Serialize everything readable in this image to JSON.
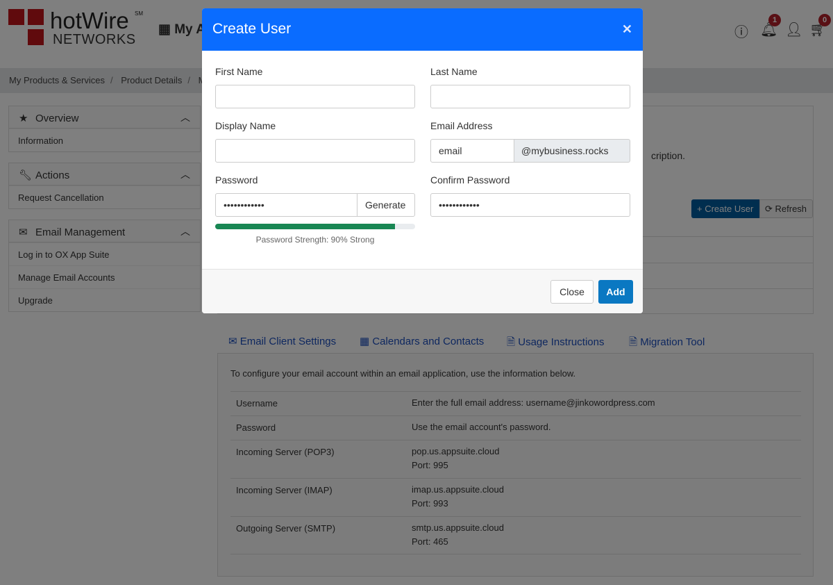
{
  "header": {
    "logo_text": "hotWire",
    "logo_sm": "SM",
    "logo_sub": "NETWORKS",
    "apps_label": "My A",
    "notif_count": "1",
    "cart_count": "0"
  },
  "breadcrumb": [
    "My Products & Services",
    "Product Details",
    "Ma"
  ],
  "sidebar": {
    "overview": {
      "title": "Overview",
      "items": [
        "Information"
      ]
    },
    "actions": {
      "title": "Actions",
      "items": [
        "Request Cancellation"
      ]
    },
    "email": {
      "title": "Email Management",
      "items": [
        "Log in to OX App Suite",
        "Manage Email Accounts",
        "Upgrade"
      ]
    }
  },
  "main": {
    "desc_fragment": "cription.",
    "create_user": "Create User",
    "refresh": "Refresh"
  },
  "tabs": [
    "Email Client Settings",
    "Calendars and Contacts",
    "Usage Instructions",
    "Migration Tool"
  ],
  "config": {
    "intro": "To configure your email account within an email application, use the information below.",
    "rows": [
      {
        "k": "Username",
        "v1": "Enter the full email address: username@jinkowordpress.com",
        "v2": ""
      },
      {
        "k": "Password",
        "v1": "Use the email account's password.",
        "v2": ""
      },
      {
        "k": "Incoming Server (POP3)",
        "v1": "pop.us.appsuite.cloud",
        "v2": "Port: 995"
      },
      {
        "k": "Incoming Server (IMAP)",
        "v1": "imap.us.appsuite.cloud",
        "v2": "Port: 993"
      },
      {
        "k": "Outgoing Server (SMTP)",
        "v1": "smtp.us.appsuite.cloud",
        "v2": "Port: 465"
      }
    ]
  },
  "modal": {
    "title": "Create User",
    "first_name_label": "First Name",
    "first_name": "",
    "last_name_label": "Last Name",
    "last_name": "",
    "display_name_label": "Display Name",
    "display_name": "",
    "email_label": "Email Address",
    "email": "email",
    "email_domain": "@mybusiness.rocks",
    "password_label": "Password",
    "password": "••••••••••••",
    "generate": "Generate",
    "confirm_label": "Confirm Password",
    "confirm": "••••••••••••",
    "strength_percent": 90,
    "strength_text": "Password Strength: 90% Strong",
    "close": "Close",
    "add": "Add"
  },
  "colors": {
    "modal_header": "#0a6cff",
    "strength_bar": "#198754",
    "primary_button": "#0a78c2",
    "badge": "#b3202a"
  }
}
